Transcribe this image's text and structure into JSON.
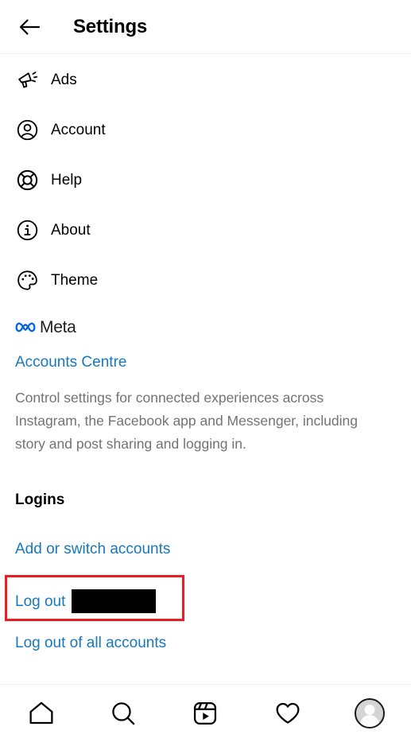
{
  "header": {
    "title": "Settings",
    "back_icon": "arrow-left-icon"
  },
  "menu": {
    "items": [
      {
        "label": "Ads",
        "icon": "megaphone-icon"
      },
      {
        "label": "Account",
        "icon": "person-circle-icon"
      },
      {
        "label": "Help",
        "icon": "lifebuoy-icon"
      },
      {
        "label": "About",
        "icon": "info-circle-icon"
      },
      {
        "label": "Theme",
        "icon": "palette-icon"
      }
    ]
  },
  "meta_section": {
    "logo_icon": "meta-infinity-icon",
    "brand": "Meta",
    "accounts_centre_link": "Accounts Centre",
    "description": "Control settings for connected experiences across Instagram, the Facebook app and Messenger, including story and post sharing and logging in."
  },
  "logins_section": {
    "heading": "Logins",
    "add_or_switch": "Add or switch accounts",
    "log_out": "Log out",
    "log_out_redacted_username": "",
    "log_out_all": "Log out of all accounts"
  },
  "bottom_nav": {
    "items": [
      {
        "name": "home",
        "icon": "home-icon"
      },
      {
        "name": "search",
        "icon": "search-icon"
      },
      {
        "name": "reels",
        "icon": "reels-icon"
      },
      {
        "name": "activity",
        "icon": "heart-icon"
      },
      {
        "name": "profile",
        "icon": "avatar-icon"
      }
    ]
  },
  "colors": {
    "link_blue": "#1878B9",
    "meta_blue": "#0064E0",
    "highlight_red": "#EE1C25",
    "muted_text": "#737373",
    "divider": "#efefef"
  }
}
